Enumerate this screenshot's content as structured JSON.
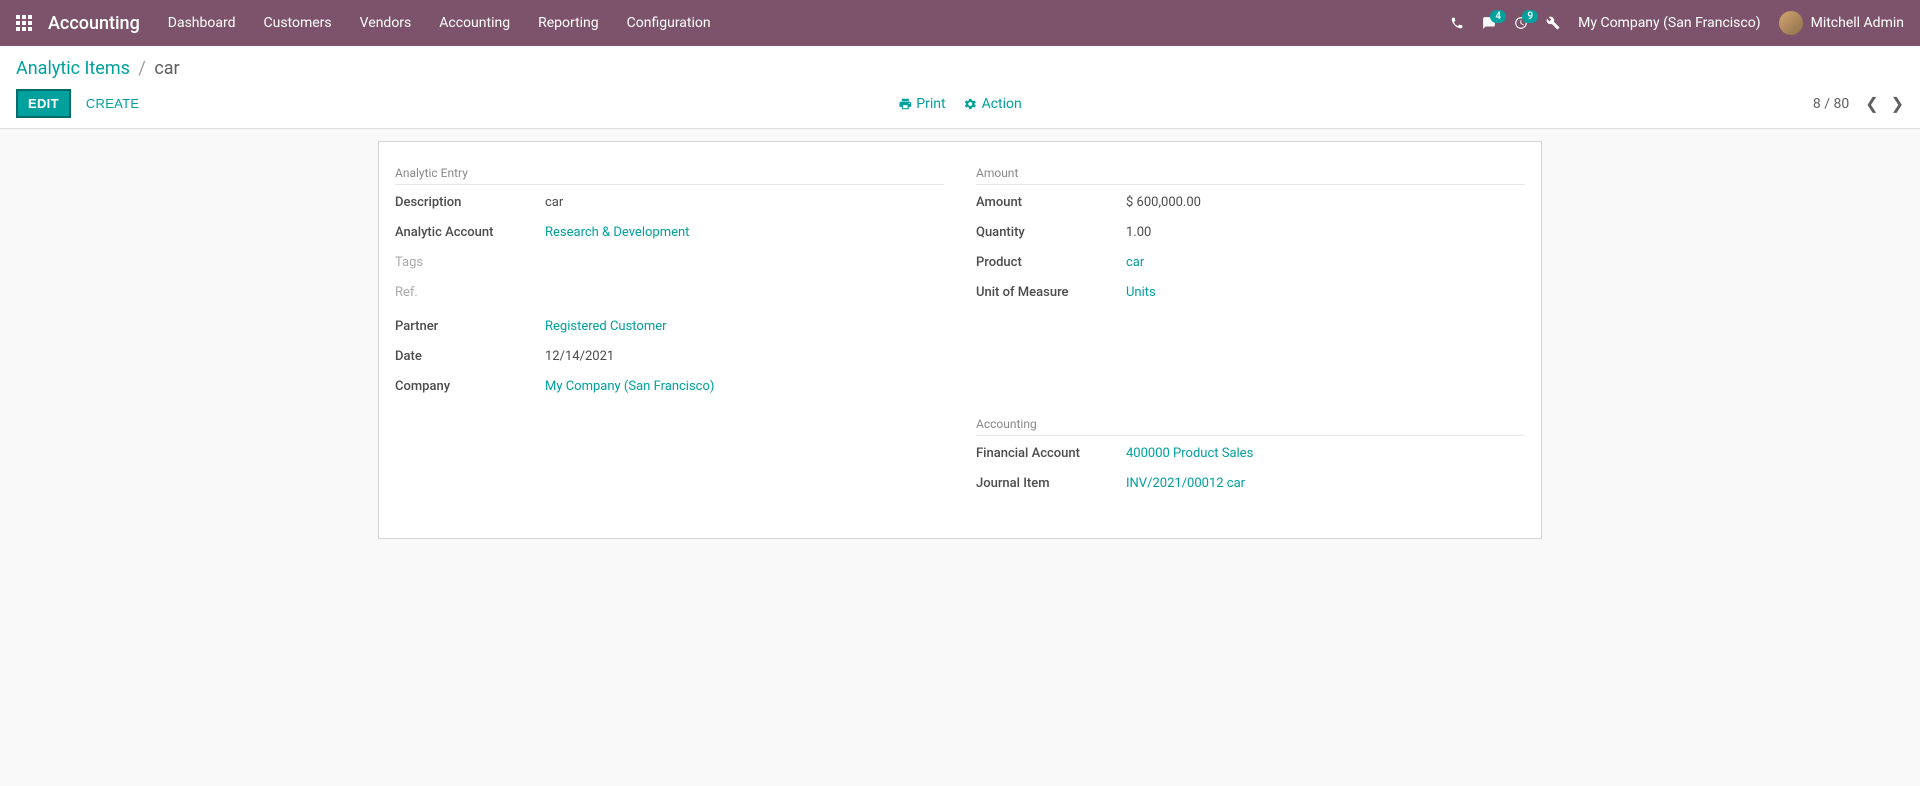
{
  "navbar": {
    "brand": "Accounting",
    "menu": [
      "Dashboard",
      "Customers",
      "Vendors",
      "Accounting",
      "Reporting",
      "Configuration"
    ],
    "messages_badge": "4",
    "activities_badge": "9",
    "company": "My Company (San Francisco)",
    "user": "Mitchell Admin"
  },
  "breadcrumb": {
    "parent": "Analytic Items",
    "current": "car"
  },
  "buttons": {
    "edit": "EDIT",
    "create": "CREATE",
    "print": "Print",
    "action": "Action"
  },
  "pager": {
    "text": "8 / 80"
  },
  "form": {
    "left": {
      "section1_title": "Analytic Entry",
      "description_label": "Description",
      "description_value": "car",
      "account_label": "Analytic Account",
      "account_value": "Research & Development",
      "tags_label": "Tags",
      "tags_value": "",
      "ref_label": "Ref.",
      "ref_value": "",
      "partner_label": "Partner",
      "partner_value": "Registered Customer",
      "date_label": "Date",
      "date_value": "12/14/2021",
      "company_label": "Company",
      "company_value": "My Company (San Francisco)"
    },
    "right": {
      "section1_title": "Amount",
      "amount_label": "Amount",
      "amount_value": "$ 600,000.00",
      "quantity_label": "Quantity",
      "quantity_value": "1.00",
      "product_label": "Product",
      "product_value": "car",
      "uom_label": "Unit of Measure",
      "uom_value": "Units",
      "section2_title": "Accounting",
      "financial_account_label": "Financial Account",
      "financial_account_value": "400000 Product Sales",
      "journal_item_label": "Journal Item",
      "journal_item_value": "INV/2021/00012 car"
    }
  }
}
